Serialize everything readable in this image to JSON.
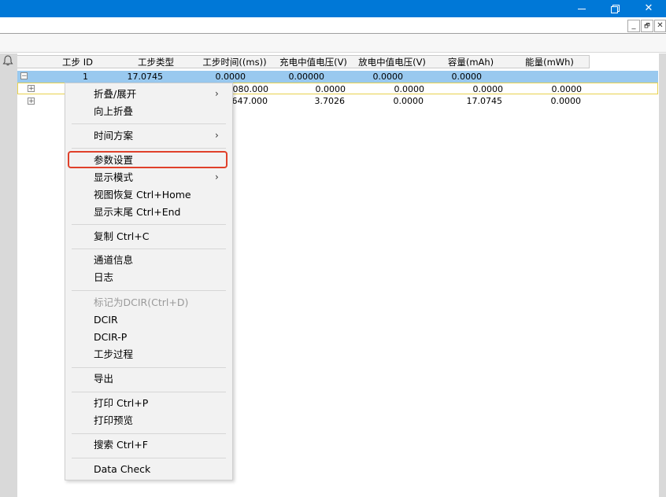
{
  "window": {
    "title_buttons": {
      "minimize": "",
      "maximize": "",
      "close": "✕"
    }
  },
  "mdi_buttons": [
    "_",
    "🗗",
    "✕"
  ],
  "table": {
    "columns": [
      "工步 ID",
      "工步类型",
      "工步时间((ms))",
      "充电中值电压(V)",
      "放电中值电压(V)",
      "容量(mAh)",
      "能量(mWh)"
    ],
    "rows": [
      {
        "expander": "−",
        "id": "1",
        "type": "17.0745",
        "time": "0.0000",
        "charge_v": "0.00000",
        "discharge_v": "0.0000",
        "capacity": "0.0000",
        "energy": ""
      },
      {
        "expander": "+",
        "id": "",
        "type": "",
        "time": "0:080.000",
        "charge_v": "0.0000",
        "discharge_v": "0.0000",
        "capacity": "0.0000",
        "energy": "0.0000"
      },
      {
        "expander": "+",
        "id": "",
        "type": "",
        "time": "0:647.000",
        "charge_v": "3.7026",
        "discharge_v": "0.0000",
        "capacity": "17.0745",
        "energy": "0.0000"
      }
    ]
  },
  "context_menu": {
    "items": {
      "fold_expand": "折叠/展开",
      "fold_up": "向上折叠",
      "time_scheme": "时间方案",
      "param_settings": "参数设置",
      "display_mode": "显示模式",
      "view_restore": "视图恢复 Ctrl+Home",
      "show_end": "显示末尾 Ctrl+End",
      "copy": "复制    Ctrl+C",
      "channel_info": "通道信息",
      "log": "日志",
      "mark_dcir": "标记为DCIR(Ctrl+D)",
      "dcir": "DCIR",
      "dcir_p": "DCIR-P",
      "step_process": "工步过程",
      "export": "导出",
      "print": "打印    Ctrl+P",
      "print_preview": "打印预览",
      "search": "搜索    Ctrl+F",
      "data_check": "Data Check"
    },
    "submenu_arrow": "›",
    "highlighted": "参数设置"
  }
}
